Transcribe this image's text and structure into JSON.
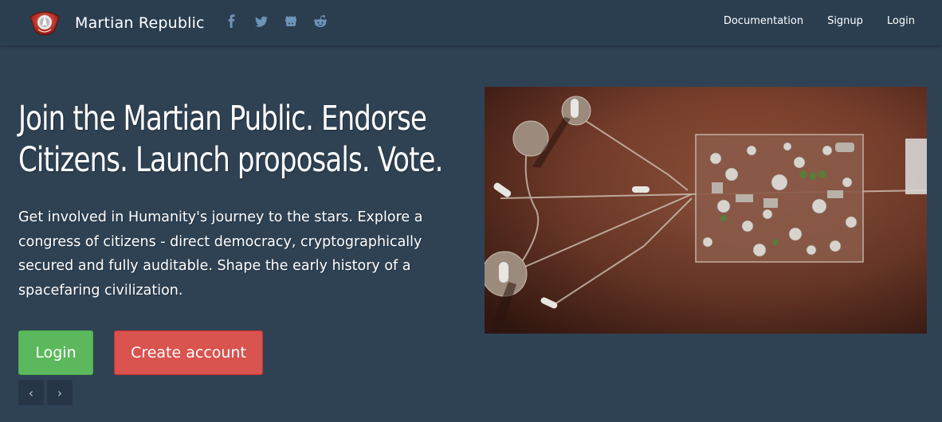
{
  "navbar": {
    "brand": "Martian Republic",
    "logo_icon": "martian-republic-logo",
    "social_icons": [
      "facebook-icon",
      "twitter-icon",
      "github-icon",
      "reddit-icon"
    ],
    "links": [
      "Documentation",
      "Signup",
      "Login"
    ]
  },
  "hero": {
    "headline_line1": "Join the Martian Public. Endorse",
    "headline_line2": "Citizens. Launch proposals. Vote.",
    "lead": "Get involved in Humanity's journey to the stars. Explore a congress of citizens - direct democracy, cryptographically secured and fully auditable. Shape the early history of a spacefaring civilization.",
    "login_label": "Login",
    "create_label": "Create account",
    "prev_label": "‹",
    "next_label": "›",
    "image_subject": "mars-colony-aerial-render"
  },
  "colors": {
    "page_bg": "#2f4254",
    "navbar_bg": "#2b3e50",
    "login_green": "#5cb85c",
    "create_red": "#d9534f",
    "icon_blue": "#6e93b8"
  }
}
